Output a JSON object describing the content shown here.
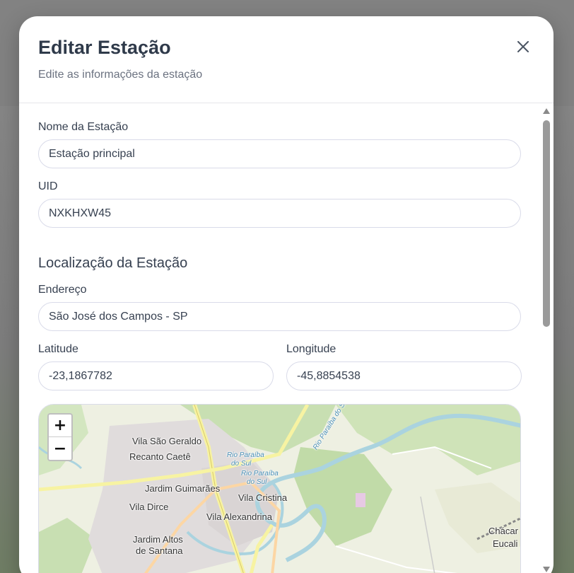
{
  "modal": {
    "title": "Editar Estação",
    "subtitle": "Edite as informações da estação"
  },
  "form": {
    "name_label": "Nome da Estação",
    "name_value": "Estação principal",
    "uid_label": "UID",
    "uid_value": "NXKHXW45",
    "location_title": "Localização da Estação",
    "address_label": "Endereço",
    "address_value": "São José dos Campos - SP",
    "latitude_label": "Latitude",
    "latitude_value": "-23,1867782",
    "longitude_label": "Longitude",
    "longitude_value": "-45,8854538"
  },
  "map": {
    "zoom_in": "+",
    "zoom_out": "−",
    "labels": {
      "vila_sao_geraldo": "Vila São Geraldo",
      "recanto_caete": "Recanto Caetê",
      "jardim_guimaraes": "Jardim Guimarães",
      "vila_cristina": "Vila Cristina",
      "vila_dirce": "Vila Dirce",
      "vila_alexandrina": "Vila Alexandrina",
      "jardim_altos": "Jardim Altos",
      "de_santana": "de Santana",
      "chacar": "Chácar",
      "eucali": "Eucali",
      "river_1a": "Rio Paraíba",
      "river_1b": "do Sul",
      "river_2a": "Rio Paraíba",
      "river_2b": "do Sul",
      "river_3": "Rio Paraíba do Sul"
    }
  },
  "colors": {
    "title": "#2f3a4a",
    "border": "#d9dbe9",
    "map_land": "#eef0e2",
    "map_green": "#c8dfb2",
    "map_water": "#aad3df",
    "map_road": "#f7f3a2"
  },
  "icons": {
    "close": "close-icon",
    "scroll_up": "triangle-up-icon",
    "scroll_down": "triangle-down-icon"
  }
}
